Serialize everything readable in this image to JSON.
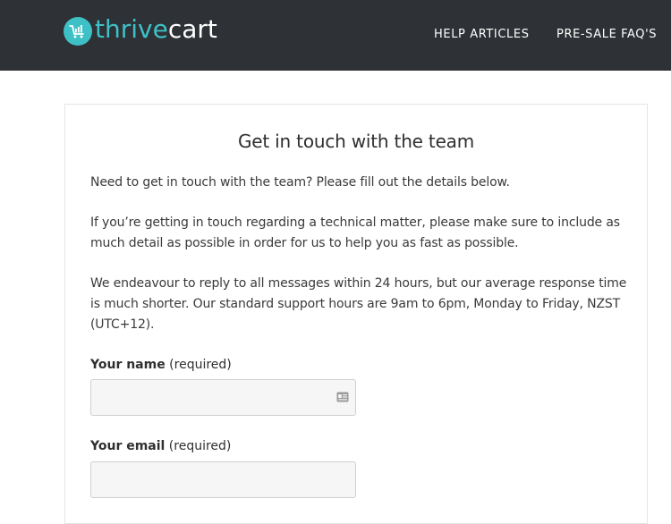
{
  "header": {
    "logo_thrive": "thrive",
    "logo_cart": "cart",
    "nav": {
      "help_articles": "HELP ARTICLES",
      "presale_faqs": "PRE-SALE FAQ'S"
    }
  },
  "main": {
    "title": "Get in touch with the team",
    "paragraphs": [
      "Need to get in touch with the team? Please fill out the details below.",
      "If you’re getting in touch regarding a technical matter, please make sure to include as much detail as possible in order for us to help you as fast as possible.",
      "We endeavour to reply to all messages within 24 hours, but our average response time is much shorter. Our standard support hours are 9am to 6pm, Monday to Friday, NZST (UTC+12)."
    ],
    "form": {
      "name_label": "Your name",
      "name_required": "(required)",
      "name_value": "",
      "name_icon": "contact-card-icon",
      "email_label": "Your email",
      "email_required": "(required)",
      "email_value": ""
    }
  },
  "colors": {
    "header_bg": "#2e3135",
    "brand_teal": "#3ec1c6",
    "nav_text": "#ffffff",
    "input_bg": "#f6f6f6",
    "input_border": "#cfcfcf"
  }
}
